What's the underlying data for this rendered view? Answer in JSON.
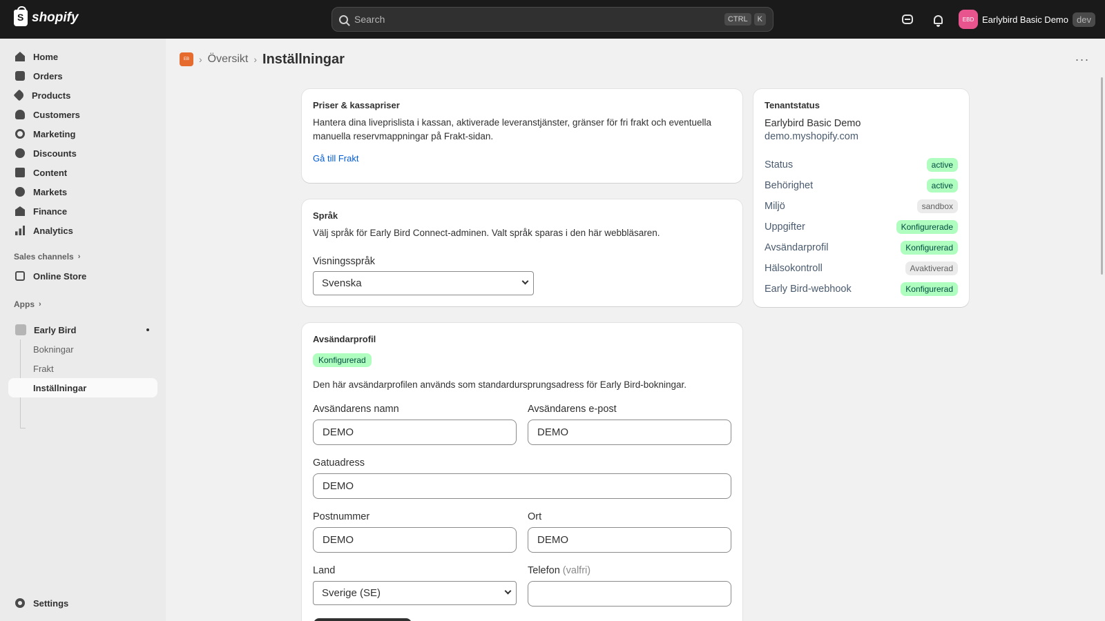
{
  "topbar": {
    "brand": "shopify",
    "search_placeholder": "Search",
    "shortcut_ctrl": "CTRL",
    "shortcut_k": "K",
    "avatar_initials": "EBD",
    "store_name": "Earlybird Basic Demo",
    "env_badge": "dev"
  },
  "sidebar": {
    "items": [
      {
        "label": "Home",
        "icon": "home-icon"
      },
      {
        "label": "Orders",
        "icon": "orders-icon"
      },
      {
        "label": "Products",
        "icon": "tag-icon"
      },
      {
        "label": "Customers",
        "icon": "person-icon"
      },
      {
        "label": "Marketing",
        "icon": "target-icon"
      },
      {
        "label": "Discounts",
        "icon": "discount-icon"
      },
      {
        "label": "Content",
        "icon": "content-icon"
      },
      {
        "label": "Markets",
        "icon": "globe-icon"
      },
      {
        "label": "Finance",
        "icon": "bank-icon"
      },
      {
        "label": "Analytics",
        "icon": "bar-chart-icon"
      }
    ],
    "sales_channels_label": "Sales channels",
    "online_store_label": "Online Store",
    "apps_label": "Apps",
    "app_name": "Early Bird",
    "app_subitems": [
      "Bokningar",
      "Frakt",
      "Inställningar"
    ],
    "settings_label": "Settings"
  },
  "header": {
    "app_logo_text": "EB",
    "breadcrumb": "Översikt",
    "title": "Inställningar"
  },
  "pricing_card": {
    "title": "Priser & kassapriser",
    "text": "Hantera dina liveprislista i kassan, aktiverade leveranstjänster, gränser för fri frakt och eventuella manuella reservmappningar på Frakt-sidan.",
    "link": "Gå till Frakt"
  },
  "language_card": {
    "title": "Språk",
    "text": "Välj språk för Early Bird Connect-adminen. Valt språk sparas i den här webbläsaren.",
    "field_label": "Visningsspråk",
    "selected": "Svenska"
  },
  "sender_card": {
    "title": "Avsändarprofil",
    "badge": "Konfigurerad",
    "text": "Den här avsändarprofilen används som standardursprungsadress för Early Bird-bokningar.",
    "name_label": "Avsändarens namn",
    "name_value": "DEMO",
    "email_label": "Avsändarens e-post",
    "email_value": "DEMO",
    "street_label": "Gatuadress",
    "street_value": "DEMO",
    "zip_label": "Postnummer",
    "zip_value": "DEMO",
    "city_label": "Ort",
    "city_value": "DEMO",
    "country_label": "Land",
    "country_value": "Sverige (SE)",
    "phone_label": "Telefon",
    "phone_optional": "(valfri)",
    "phone_value": ""
  },
  "tenant_card": {
    "title": "Tenantstatus",
    "store_name": "Earlybird Basic Demo",
    "domain": "demo.myshopify.com",
    "rows": [
      {
        "label": "Status",
        "value": "active",
        "tone": "green"
      },
      {
        "label": "Behörighet",
        "value": "active",
        "tone": "green"
      },
      {
        "label": "Miljö",
        "value": "sandbox",
        "tone": "gray"
      },
      {
        "label": "Uppgifter",
        "value": "Konfigurerade",
        "tone": "green"
      },
      {
        "label": "Avsändarprofil",
        "value": "Konfigurerad",
        "tone": "green"
      },
      {
        "label": "Hälsokontroll",
        "value": "Avaktiverad",
        "tone": "gray"
      },
      {
        "label": "Early Bird-webhook",
        "value": "Konfigurerad",
        "tone": "green"
      }
    ]
  },
  "colors": {
    "topbar_bg": "#1a1a1a",
    "page_bg": "#f1f1f1",
    "link": "#005bd3",
    "badge_green": "#affebf",
    "badge_gray": "#ebebeb",
    "app_accent": "#e56b2e",
    "avatar": "#e8558e"
  }
}
